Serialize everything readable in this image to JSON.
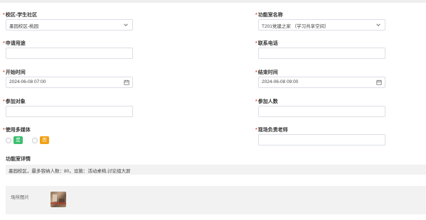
{
  "form": {
    "campus": {
      "label": "校区-学生社区",
      "value": "墨园校区-桃园"
    },
    "room_name": {
      "label": "功能室名称",
      "value": "T201党建之家 （学习共享空间）"
    },
    "purpose": {
      "label": "申请用途",
      "value": ""
    },
    "phone": {
      "label": "联系电话",
      "value": ""
    },
    "start_time": {
      "label": "开始时间",
      "value": "2024-06-08 07:00"
    },
    "end_time": {
      "label": "结束时间",
      "value": "2024-06-08 09:00"
    },
    "audience": {
      "label": "参加对象",
      "value": ""
    },
    "participants": {
      "label": "参加人数",
      "value": ""
    },
    "multimedia": {
      "label": "使用多媒体",
      "options": [
        "是",
        "否"
      ]
    },
    "teacher": {
      "label": "现场负责老师",
      "value": ""
    },
    "required_mark": "*"
  },
  "details": {
    "title": "功能室详情",
    "text": "墨园校区，最多容纳人数：80，设施：活动桌椅,讨论组大屏"
  },
  "photo": {
    "label": "场所图片"
  },
  "colors": {
    "required": "#e5533d",
    "yes_tag": "#3dbf6f",
    "no_tag": "#f0a116",
    "border": "#dcdfe6"
  },
  "icons": {
    "select": "chevron-down-icon",
    "date": "calendar-icon"
  }
}
